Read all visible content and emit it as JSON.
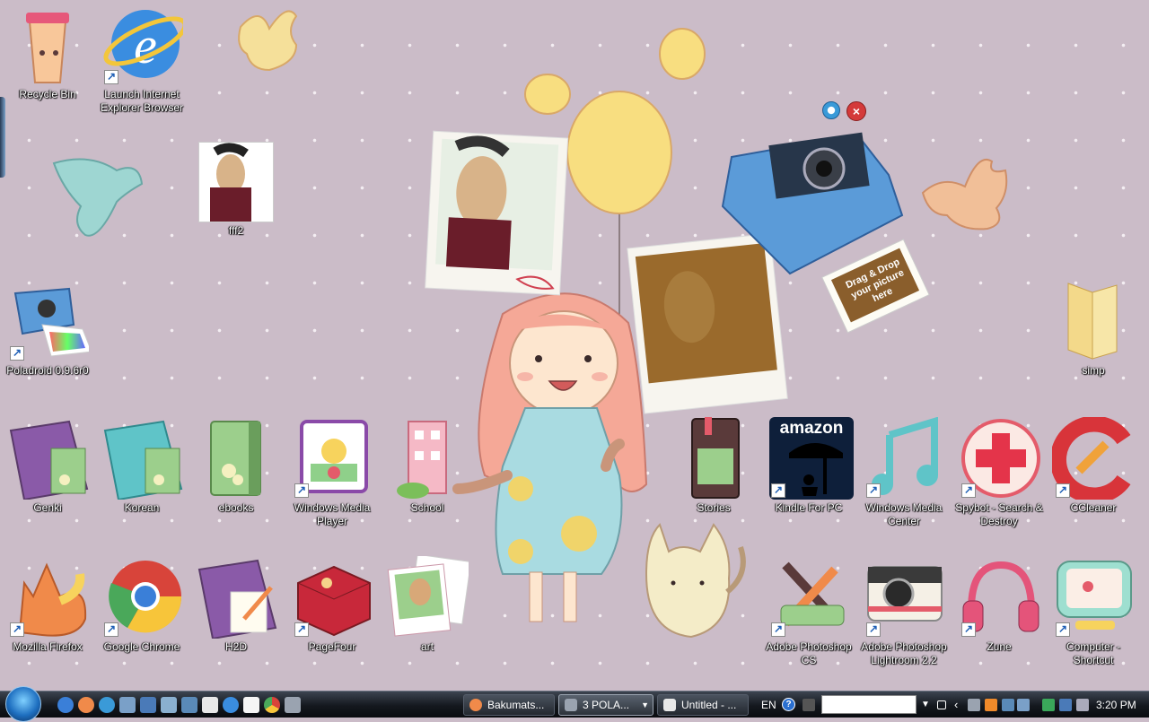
{
  "desktop": {
    "icons": {
      "recycle_bin": "Recycle Bin",
      "ie": "Launch Internet Explorer Browser",
      "fff2": "fff2",
      "poladroid": "Poladroid 0.9.6r0",
      "simp": "simp",
      "genki": "Genki",
      "korean": "Korean",
      "ebooks": "ebooks",
      "wmp": "Windows Media Player",
      "school": "School",
      "stories": "Stories",
      "kindle": "Kindle For PC",
      "wmc": "Windows Media Center",
      "spybot": "Spybot - Search & Destroy",
      "ccleaner": "CCleaner",
      "firefox": "Mozilla Firefox",
      "chrome": "Google Chrome",
      "h2d": "H2D",
      "pagefour": "PageFour",
      "art": "art",
      "photoshop": "Adobe Photoshop CS",
      "lightroom": "Adobe Photoshop Lightroom 2.2",
      "zune": "Zune",
      "computer": "Computer - Shortcut"
    },
    "kindle_logo": "amazon",
    "polaroid_gadget": {
      "drop_text": "Drag & Drop your picture here"
    }
  },
  "taskbar": {
    "tasks": [
      "Bakumats...",
      "3 POLA...",
      "Untitled - ..."
    ],
    "language": "EN",
    "help_glyph": "?",
    "clock": "3:20 PM"
  },
  "colors": {
    "desktop_bg": "#cbbcc8",
    "taskbar_bg": "#14181e"
  }
}
